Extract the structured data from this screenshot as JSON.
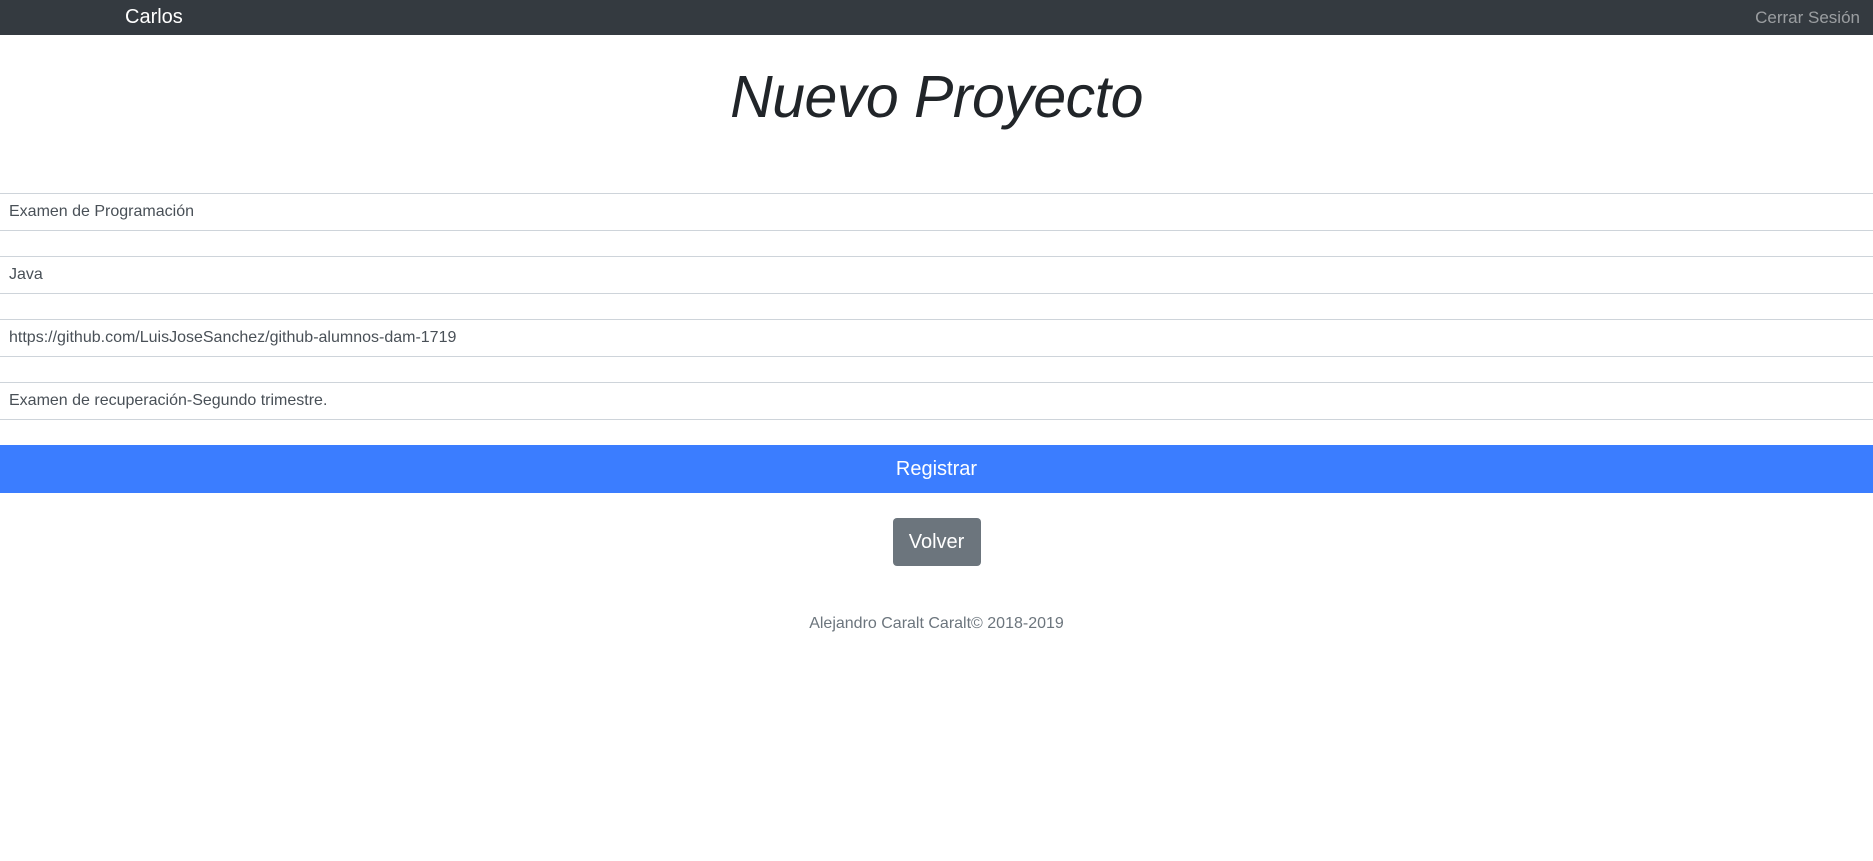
{
  "navbar": {
    "brand": "Carlos",
    "logout_label": "Cerrar Sesión"
  },
  "page": {
    "title": "Nuevo Proyecto"
  },
  "form": {
    "fields": [
      {
        "value": "Examen de Programación"
      },
      {
        "value": "Java"
      },
      {
        "value": "https://github.com/LuisJoseSanchez/github-alumnos-dam-1719"
      },
      {
        "value": "Examen de recuperación-Segundo trimestre."
      }
    ],
    "submit_label": "Registrar"
  },
  "back_label": "Volver",
  "footer": {
    "text": "Alejandro Caralt Caralt© 2018-2019"
  },
  "colors": {
    "navbar_bg": "#343a40",
    "primary": "#3b7dff",
    "secondary": "#6c757d"
  }
}
